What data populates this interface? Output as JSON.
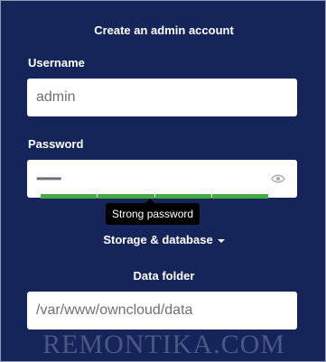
{
  "title": "Create an admin account",
  "username": {
    "label": "Username",
    "value": "admin"
  },
  "password": {
    "label": "Password",
    "masked_value": "••••••••••••",
    "strength_text": "Strong password",
    "strength_level": 1.0,
    "strength_color": "#44aa44",
    "toggle_icon": "eye-icon"
  },
  "storage": {
    "label": "Storage & database"
  },
  "data_folder": {
    "label": "Data folder",
    "value": "/var/www/owncloud/data"
  },
  "watermark": "REMONTIKA.COM",
  "colors": {
    "background": "#15255a",
    "input_bg": "#ffffff",
    "tooltip_bg": "#000000"
  }
}
